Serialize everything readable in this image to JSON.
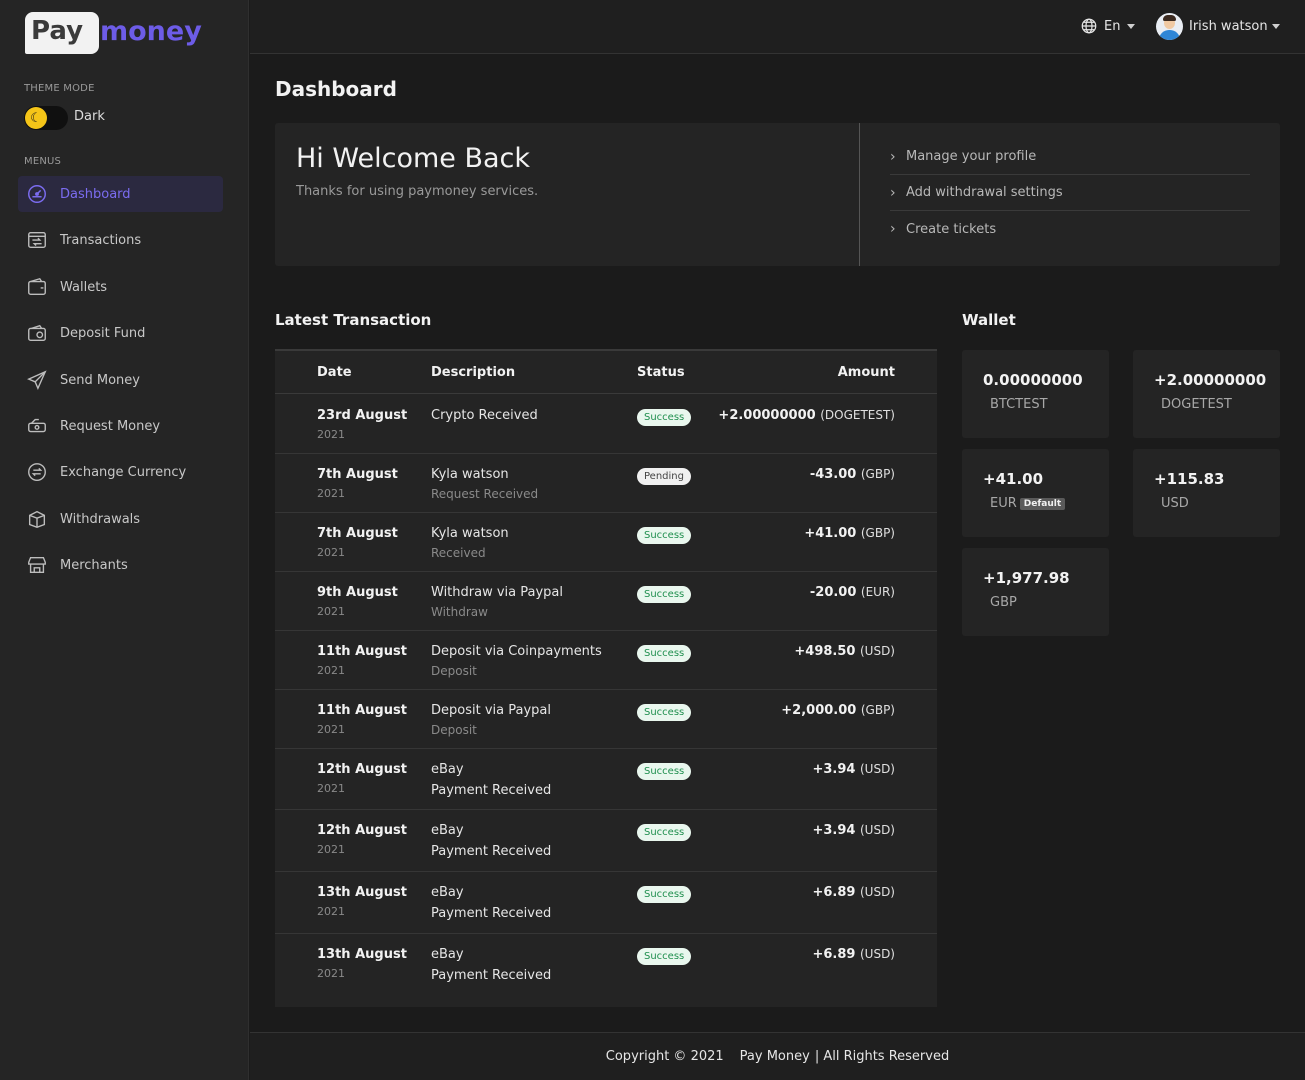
{
  "brand": {
    "logo_pay": "Pay",
    "logo_money": "money"
  },
  "sidebar": {
    "theme_mode_label": "THEME MODE",
    "theme_value": "Dark",
    "menus_label": "MENUS",
    "items": [
      {
        "label": "Dashboard",
        "icon": "speedometer-icon",
        "active": true
      },
      {
        "label": "Transactions",
        "icon": "transactions-icon"
      },
      {
        "label": "Wallets",
        "icon": "wallet-icon"
      },
      {
        "label": "Deposit Fund",
        "icon": "deposit-icon"
      },
      {
        "label": "Send Money",
        "icon": "send-icon"
      },
      {
        "label": "Request Money",
        "icon": "request-money-icon"
      },
      {
        "label": "Exchange Currency",
        "icon": "exchange-icon"
      },
      {
        "label": "Withdrawals",
        "icon": "withdrawal-icon"
      },
      {
        "label": "Merchants",
        "icon": "merchant-icon"
      }
    ]
  },
  "topbar": {
    "language": "En",
    "user_name": "Irish watson"
  },
  "main": {
    "title": "Dashboard",
    "welcome": {
      "heading": "Hi Welcome Back",
      "subtext": "Thanks for using paymoney services.",
      "links": [
        "Manage your profile",
        "Add withdrawal settings",
        "Create tickets"
      ]
    }
  },
  "transactions": {
    "title": "Latest Transaction",
    "headers": {
      "date": "Date",
      "description": "Description",
      "status": "Status",
      "amount": "Amount"
    },
    "rows": [
      {
        "date": "23rd August",
        "year": "2021",
        "desc": "Crypto Received",
        "sub": "",
        "status": "Success",
        "amount": "+2.00000000",
        "currency": "(DOGETEST)"
      },
      {
        "date": "7th August",
        "year": "2021",
        "desc": "Kyla watson",
        "sub": "Request Received",
        "status": "Pending",
        "amount": "-43.00",
        "currency": "(GBP)"
      },
      {
        "date": "7th August",
        "year": "2021",
        "desc": "Kyla watson",
        "sub": "Received",
        "status": "Success",
        "amount": "+41.00",
        "currency": "(GBP)"
      },
      {
        "date": "9th August",
        "year": "2021",
        "desc": "Withdraw via Paypal",
        "sub": "Withdraw",
        "status": "Success",
        "amount": "-20.00",
        "currency": "(EUR)"
      },
      {
        "date": "11th August",
        "year": "2021",
        "desc": "Deposit via Coinpayments",
        "sub": "Deposit",
        "status": "Success",
        "amount": "+498.50",
        "currency": "(USD)"
      },
      {
        "date": "11th August",
        "year": "2021",
        "desc": "Deposit via Paypal",
        "sub": "Deposit",
        "status": "Success",
        "amount": "+2,000.00",
        "currency": "(GBP)"
      },
      {
        "date": "12th August",
        "year": "2021",
        "desc": "eBay",
        "sub": "Payment Received",
        "status": "Success",
        "amount": "+3.94",
        "currency": "(USD)"
      },
      {
        "date": "12th August",
        "year": "2021",
        "desc": "eBay",
        "sub": "Payment Received",
        "status": "Success",
        "amount": "+3.94",
        "currency": "(USD)"
      },
      {
        "date": "13th August",
        "year": "2021",
        "desc": "eBay",
        "sub": "Payment Received",
        "status": "Success",
        "amount": "+6.89",
        "currency": "(USD)"
      },
      {
        "date": "13th August",
        "year": "2021",
        "desc": "eBay",
        "sub": "Payment Received",
        "status": "Success",
        "amount": "+6.89",
        "currency": "(USD)"
      }
    ]
  },
  "wallet": {
    "title": "Wallet",
    "default_label": "Default",
    "cards": [
      {
        "balance": "0.00000000",
        "currency": "BTCTEST"
      },
      {
        "balance": "+2.00000000",
        "currency": "DOGETEST"
      },
      {
        "balance": "+41.00",
        "currency": "EUR",
        "default": true
      },
      {
        "balance": "+115.83",
        "currency": "USD"
      },
      {
        "balance": "+1,977.98",
        "currency": "GBP"
      }
    ]
  },
  "footer": {
    "copyright": "Copyright © 2021",
    "brand": "Pay Money",
    "rights": "| All Rights Reserved"
  },
  "colors": {
    "accent": "#7b6cf0",
    "background": "#1b1b1b",
    "card": "#242424",
    "success": "#1f8f4e"
  }
}
